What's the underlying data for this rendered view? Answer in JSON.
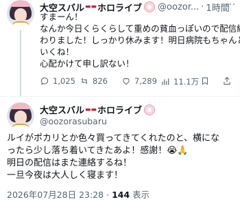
{
  "tweet1": {
    "display_name": "大空スバル",
    "name_suffix": "ホロライブ",
    "handle": "@oozor...",
    "separator": "·",
    "time": "1時間",
    "more": "···",
    "lines": [
      "すまーん！",
      "なんか今日くらくらして重めの貧血っぽいので配信終",
      "わりました！しっかり休みます！明日病院もちゃんと",
      "いくね！",
      "心配かけて申し訳ない！"
    ],
    "replies": "1,025",
    "reposts": "826",
    "likes": "7,289",
    "views": "11.1万"
  },
  "tweet2": {
    "display_name": "大空スバル",
    "name_suffix": "ホロライブ",
    "handle": "@oozorasubaru",
    "lines": [
      "ルイがポカリとか色々買ってきてくれたのと、横にな",
      "ったら少し落ち着いてきたあよ！感謝！😭🙏",
      "明日の配信はまた連絡するね！",
      "一旦今夜は大人しく寝ます！"
    ],
    "timestamp": "2026年07月28日 23:28",
    "separator": "·",
    "view_count": "144",
    "view_label": "表示"
  },
  "icons": {
    "reply": "reply-icon",
    "repost": "repost-icon",
    "like": "heart-icon",
    "views": "views-icon",
    "bookmark": "bookmark-icon",
    "share": "share-icon",
    "badge": "affiliate-badge-icon",
    "car": "car-emoji-icon"
  },
  "colors": {
    "text": "#0f1419",
    "muted": "#536471",
    "divider": "#eff3f4",
    "car": "#c6203c"
  }
}
